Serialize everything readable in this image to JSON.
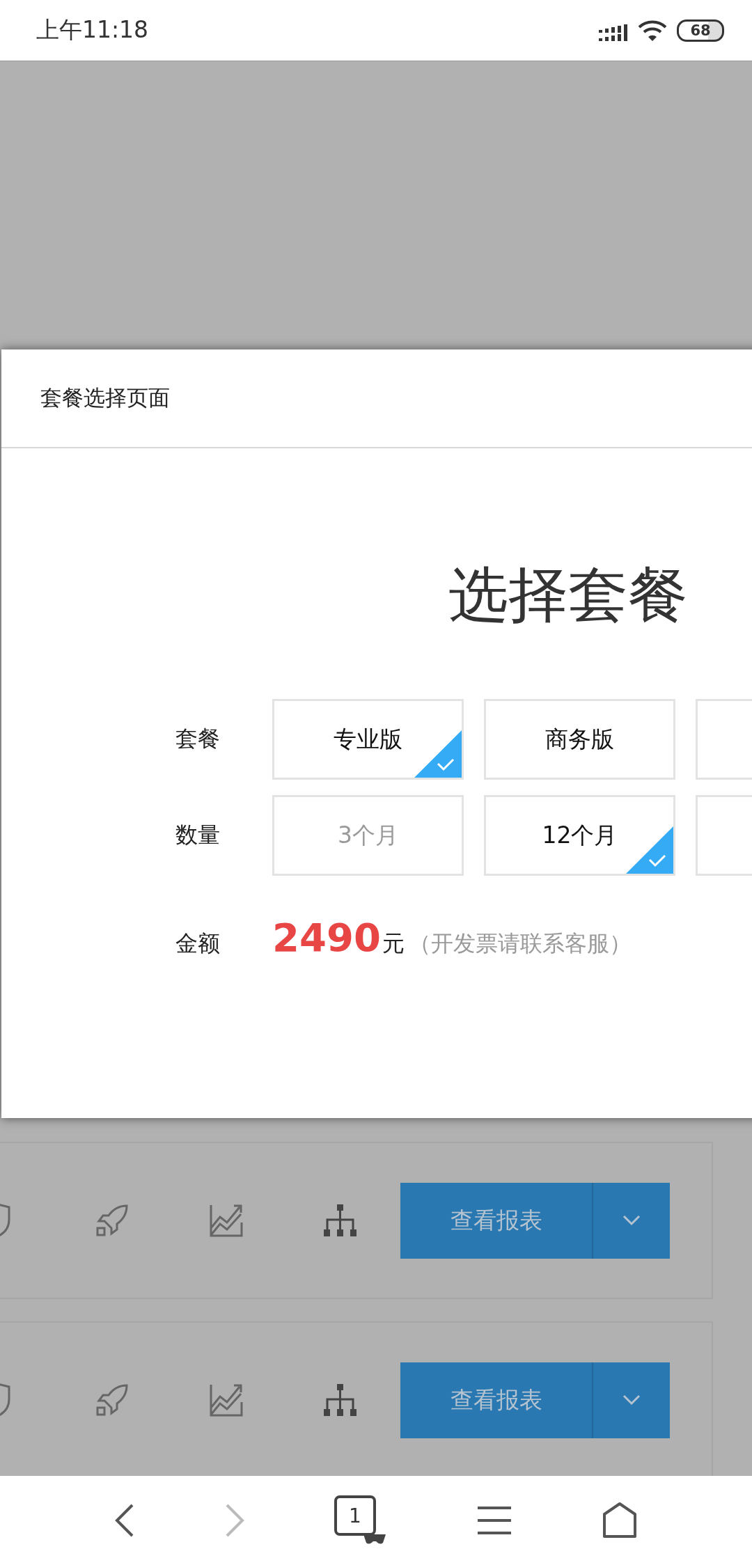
{
  "status_bar": {
    "time": "上午11:18",
    "battery": "68"
  },
  "modal": {
    "title": "套餐选择页面",
    "heading": "选择套餐",
    "rows": [
      {
        "label": "套餐",
        "options": [
          {
            "label": "专业版",
            "selected": true,
            "disabled": false
          },
          {
            "label": "商务版",
            "selected": false,
            "disabled": false
          }
        ]
      },
      {
        "label": "数量",
        "options": [
          {
            "label": "3个月",
            "selected": false,
            "disabled": true
          },
          {
            "label": "12个月",
            "selected": true,
            "disabled": false
          }
        ]
      }
    ],
    "amount": {
      "label": "金额",
      "value": "2490",
      "unit": "元",
      "note": "（开发票请联系客服）"
    }
  },
  "background_cards": [
    {
      "button": "查看报表"
    },
    {
      "button": "查看报表"
    }
  ],
  "bottom_nav": {
    "tab_count": "1",
    "forward_disabled": true
  }
}
